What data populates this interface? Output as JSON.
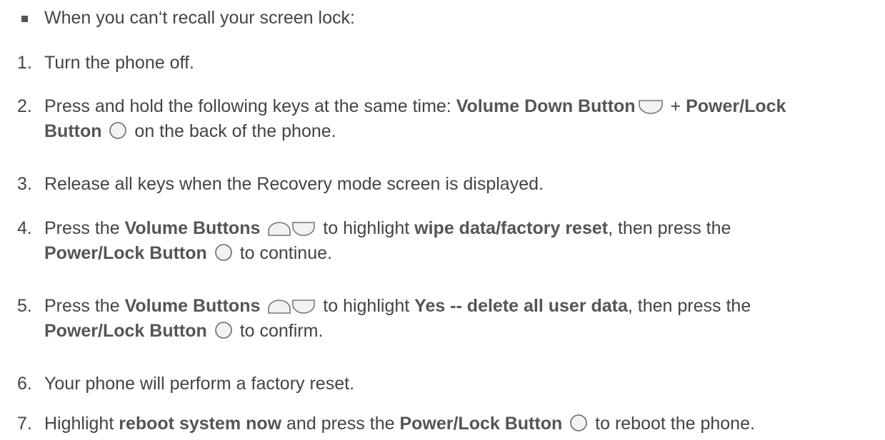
{
  "intro": {
    "text": "When you can‘t recall your screen lock:"
  },
  "steps": [
    {
      "number": "1.",
      "parts": [
        "Turn the phone off."
      ]
    },
    {
      "number": "2.",
      "parts": [
        "Press and hold the following keys at the same time: ",
        "Volume Down Button",
        " + ",
        "Power/Lock",
        "Button",
        " on the back of the phone."
      ]
    },
    {
      "number": "3.",
      "parts": [
        "Release all keys when the Recovery mode screen is displayed."
      ]
    },
    {
      "number": "4.",
      "parts": [
        "Press the ",
        "Volume Buttons",
        " to highlight ",
        "wipe data/factory reset",
        ", then press the",
        "Power/Lock Button",
        " to continue."
      ]
    },
    {
      "number": "5.",
      "parts": [
        "Press the ",
        "Volume Buttons",
        " to highlight ",
        "Yes -- delete all user data",
        ", then press the",
        "Power/Lock Button",
        " to confirm."
      ]
    },
    {
      "number": "6.",
      "parts": [
        "Your phone will perform a factory reset."
      ]
    },
    {
      "number": "7.",
      "parts": [
        "Highlight ",
        "reboot system now",
        " and press the ",
        "Power/Lock Button",
        " to reboot the phone."
      ]
    }
  ],
  "icons": {
    "volume_up": "volume-up-key-icon",
    "volume_down": "volume-down-key-icon",
    "power": "power-lock-key-icon",
    "icon_stroke": "#777777",
    "icon_fill": "#f2f2f2"
  }
}
